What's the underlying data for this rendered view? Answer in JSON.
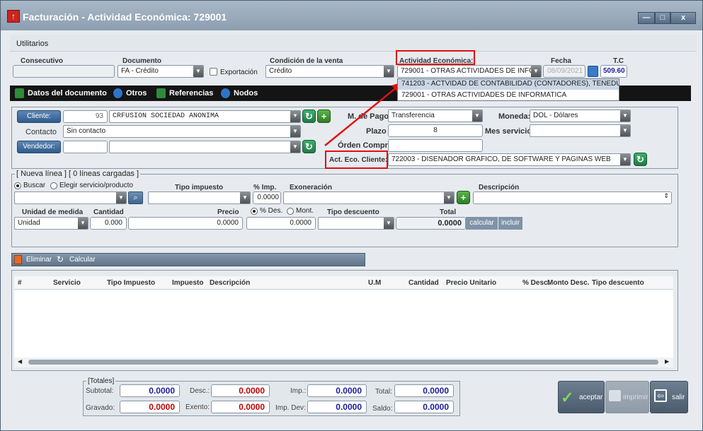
{
  "window": {
    "title": "Facturación - Actividad Económica: 729001",
    "min": "—",
    "max": "□",
    "close": "x"
  },
  "menu": {
    "utilitarios": "Utilitarios"
  },
  "top": {
    "consecutivo_label": "Consecutivo",
    "consecutivo_value": "",
    "documento_label": "Documento",
    "documento_value": "FA - Crédito",
    "exportacion_label": "Exportación",
    "condicion_label": "Condición de la venta",
    "condicion_value": "Crédito",
    "actividad_label": "Actividad Económica:",
    "actividad_value": "729001 - OTRAS ACTIVIDADES DE INFC",
    "actividad_options": [
      "741203 - ACTVIDAD DE CONTABILIDAD (CONTADORES), TENEDU",
      "729001 - OTRAS ACTIVIDADES DE INFORMATICA"
    ],
    "fecha_label": "Fecha",
    "fecha_value": "08/09/2021",
    "tc_label": "T.C",
    "tc_value": "509.60"
  },
  "tabs": [
    "Datos del documento",
    "Otros",
    "Referencias",
    "Nodos"
  ],
  "cliente": {
    "cliente_btn": "Cliente:",
    "cliente_code": "93",
    "cliente_name": "CRFUSION SOCIEDAD ANONIMA",
    "contacto_label": "Contacto",
    "contacto_value": "Sin contacto",
    "vendedor_btn": "Vendedor:",
    "vendedor_code": "",
    "vendedor_name": "",
    "mpago_label": "M. de Pago",
    "mpago_value": "Transferencia",
    "plazo_label": "Plazo",
    "plazo_value": "8",
    "orden_label": "Órden Compra",
    "orden_value": "",
    "aeco_label": "Act. Eco. Cliente:",
    "aeco_value": "722003 - DISENADOR GRAFICO, DE SOFTWARE Y PAGINAS WEB",
    "moneda_label": "Moneda:",
    "moneda_value": "DOL - Dólares",
    "messervicio_label": "Mes servicio:",
    "messervicio_value": ""
  },
  "linea": {
    "legend": "[ Nueva línea ] [ 0 líneas cargadas ]",
    "buscar": "Buscar",
    "elegir": "Elegir servicio/producto",
    "tipoimp_label": "Tipo impuesto",
    "pimp_label": "% Imp.",
    "pimp_value": "0.0000",
    "exon_label": "Exoneración",
    "desc_label": "Descripción",
    "um_label": "Unidad de medida",
    "um_value": "Unidad",
    "cant_label": "Cantidad",
    "cant_value": "0.000",
    "precio_label": "Precio",
    "precio_value": "0.0000",
    "pdes": "% Des.",
    "mont": "Mont.",
    "desc_value": "0.0000",
    "tipodesc_label": "Tipo descuento",
    "total_label": "Total",
    "total_value": "0.0000",
    "calcular": "calcular",
    "incluir": "incluir"
  },
  "actions": {
    "eliminar": "Eliminar",
    "calcular": "Calcular"
  },
  "grid": {
    "columns": [
      "#",
      "Servicio",
      "Tipo Impuesto",
      "Impuesto",
      "Descripción",
      "U.M",
      "Cantidad",
      "Precio Unitario",
      "% Desc.",
      "Monto Desc.",
      "Tipo descuento"
    ]
  },
  "totales": {
    "legend": "[Totales]",
    "subtotal_label": "Subtotal:",
    "subtotal": "0.0000",
    "desc_label": "Desc.:",
    "desc": "0.0000",
    "imp_label": "Imp.:",
    "imp": "0.0000",
    "total_label": "Total:",
    "total": "0.0000",
    "gravado_label": "Gravado:",
    "gravado": "0.0000",
    "exento_label": "Exento:",
    "exento": "0.0000",
    "impdev_label": "Imp. Dev:",
    "impdev": "0.0000",
    "saldo_label": "Saldo:",
    "saldo": "0.0000"
  },
  "footer": {
    "aceptar": "aceptar",
    "imprimir": "imprimir",
    "salir": "salir"
  },
  "colors": {
    "red": "#e01010",
    "blue": "#1a1aa0",
    "redval": "#c00000"
  }
}
